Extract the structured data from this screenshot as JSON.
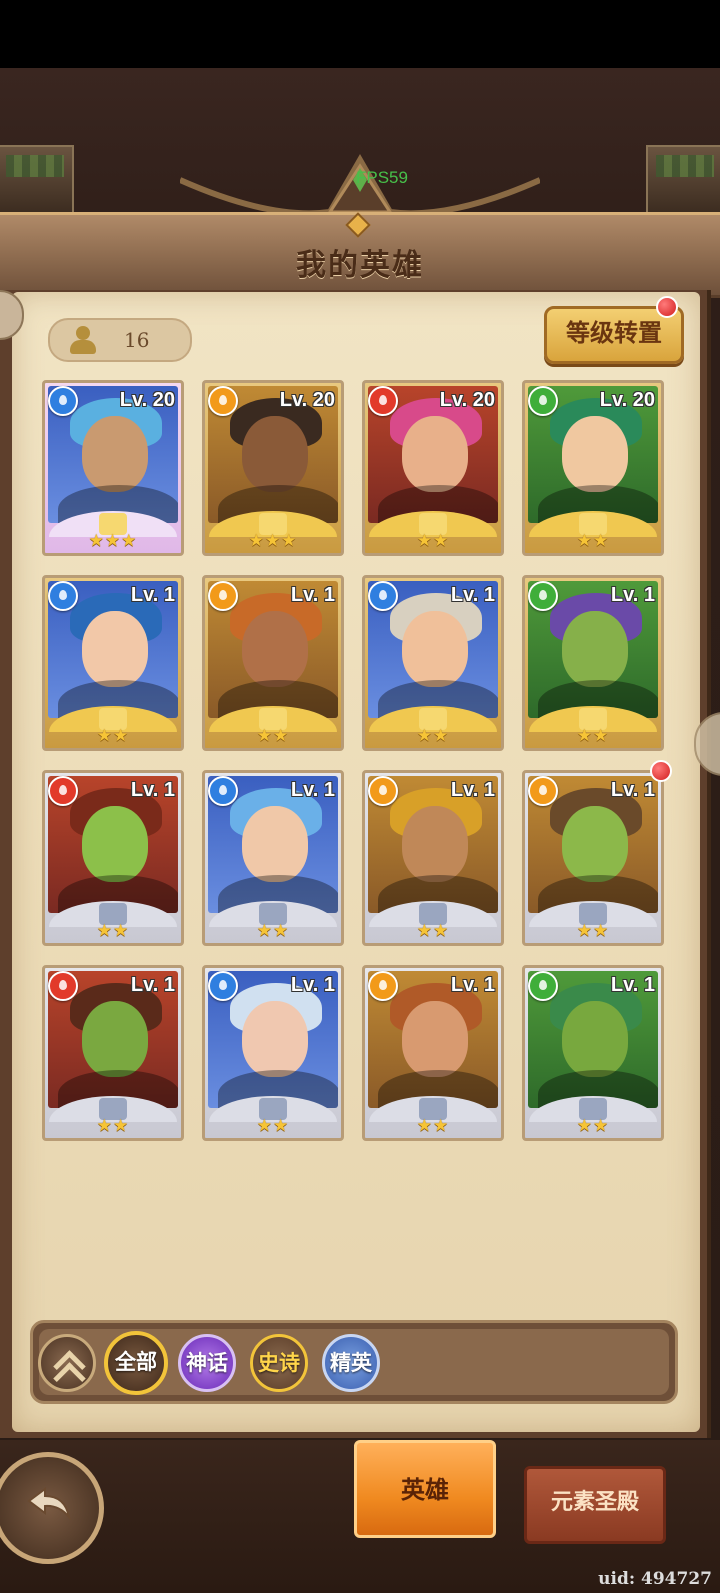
{
  "hud": {
    "fps": "FPS59"
  },
  "header": {
    "title": "我的英雄"
  },
  "roster": {
    "count": "16",
    "reset_label": "等级转置",
    "reset_has_notice": true
  },
  "colors": {
    "water": "#2f7fe0",
    "fire": "#e23a2a",
    "light": "#f29a1a",
    "nature": "#3fae3a"
  },
  "heroes": [
    {
      "level": "Lv. 20",
      "element": "water-icon",
      "stars": "★★★",
      "rarity": "mythic"
    },
    {
      "level": "Lv. 20",
      "element": "light-icon",
      "stars": "★★★",
      "rarity": "epic"
    },
    {
      "level": "Lv. 20",
      "element": "fire-icon",
      "stars": "★★",
      "rarity": "epic"
    },
    {
      "level": "Lv. 20",
      "element": "nature-icon",
      "stars": "★★",
      "rarity": "epic"
    },
    {
      "level": "Lv. 1",
      "element": "water-icon",
      "stars": "★★",
      "rarity": "epic"
    },
    {
      "level": "Lv. 1",
      "element": "light-icon",
      "stars": "★★",
      "rarity": "epic"
    },
    {
      "level": "Lv. 1",
      "element": "water-icon",
      "stars": "★★",
      "rarity": "epic"
    },
    {
      "level": "Lv. 1",
      "element": "nature-icon",
      "stars": "★★",
      "rarity": "epic"
    },
    {
      "level": "Lv. 1",
      "element": "fire-icon",
      "stars": "★★",
      "rarity": "elite"
    },
    {
      "level": "Lv. 1",
      "element": "water-icon",
      "stars": "★★",
      "rarity": "elite"
    },
    {
      "level": "Lv. 1",
      "element": "light-icon",
      "stars": "★★",
      "rarity": "elite"
    },
    {
      "level": "Lv. 1",
      "element": "light-icon",
      "stars": "★★",
      "rarity": "elite",
      "notice": true
    },
    {
      "level": "Lv. 1",
      "element": "fire-icon",
      "stars": "★★",
      "rarity": "elite"
    },
    {
      "level": "Lv. 1",
      "element": "water-icon",
      "stars": "★★",
      "rarity": "elite"
    },
    {
      "level": "Lv. 1",
      "element": "light-icon",
      "stars": "★★",
      "rarity": "elite"
    },
    {
      "level": "Lv. 1",
      "element": "nature-icon",
      "stars": "★★",
      "rarity": "elite"
    }
  ],
  "filters": {
    "all": "全部",
    "mythic": "神话",
    "epic": "史诗",
    "elite": "精英"
  },
  "tabs": {
    "hero": "英雄",
    "temple": "元素圣殿"
  },
  "footer": {
    "uid": "uid: 494727"
  }
}
